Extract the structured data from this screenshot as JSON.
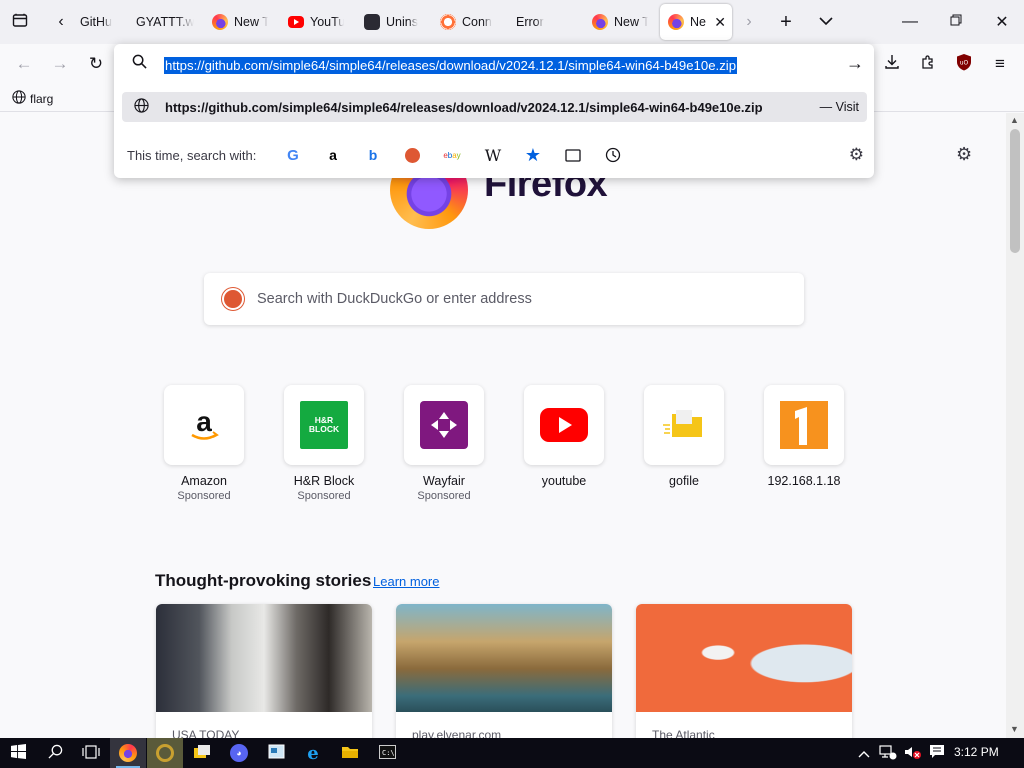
{
  "tabs": [
    {
      "label": "GitHu",
      "favicon": "github-favicon"
    },
    {
      "label": "GYATTT.w",
      "favicon": "none"
    },
    {
      "label": "New T",
      "favicon": "firefox-favicon"
    },
    {
      "label": "YouTu",
      "favicon": "youtube-favicon"
    },
    {
      "label": "Unins",
      "favicon": "page-favicon"
    },
    {
      "label": "Conn",
      "favicon": "connection-favicon"
    },
    {
      "label": "Error",
      "favicon": "none"
    },
    {
      "label": "New T",
      "favicon": "firefox-favicon"
    },
    {
      "label": "Ne",
      "favicon": "firefox-favicon",
      "active": true
    }
  ],
  "urlbar": {
    "value": "https://github.com/simple64/simple64/releases/download/v2024.12.1/simple64-win64-b49e10e.zip",
    "suggestion": "https://github.com/simple64/simple64/releases/download/v2024.12.1/simple64-win64-b49e10e.zip",
    "suggestion_action": "— Visit",
    "search_with_label": "This time, search with:",
    "engines": [
      "google",
      "amazon",
      "bing",
      "duckduckgo",
      "ebay",
      "wikipedia",
      "bookmarks",
      "tabs",
      "history"
    ]
  },
  "bookmarks": [
    {
      "label": "flarg"
    }
  ],
  "newtab": {
    "brand": "Firefox",
    "search_placeholder": "Search with DuckDuckGo or enter address",
    "shortcuts": [
      {
        "label": "Amazon",
        "sponsored": "Sponsored"
      },
      {
        "label": "H&R Block",
        "sponsored": "Sponsored",
        "logo_text": "H&R BLOCK"
      },
      {
        "label": "Wayfair",
        "sponsored": "Sponsored"
      },
      {
        "label": "youtube"
      },
      {
        "label": "gofile"
      },
      {
        "label": "192.168.1.18"
      }
    ],
    "stories_title": "Thought-provoking stories",
    "learn_more": "Learn more",
    "stories": [
      {
        "source": "USA TODAY"
      },
      {
        "source": "play.elvenar.com"
      },
      {
        "source": "The Atlantic"
      }
    ]
  },
  "taskbar": {
    "time": "3:12 PM"
  },
  "colors": {
    "accent": "#0060df",
    "tab_strip": "#f0f0f4",
    "taskbar": "#0b0b14"
  }
}
